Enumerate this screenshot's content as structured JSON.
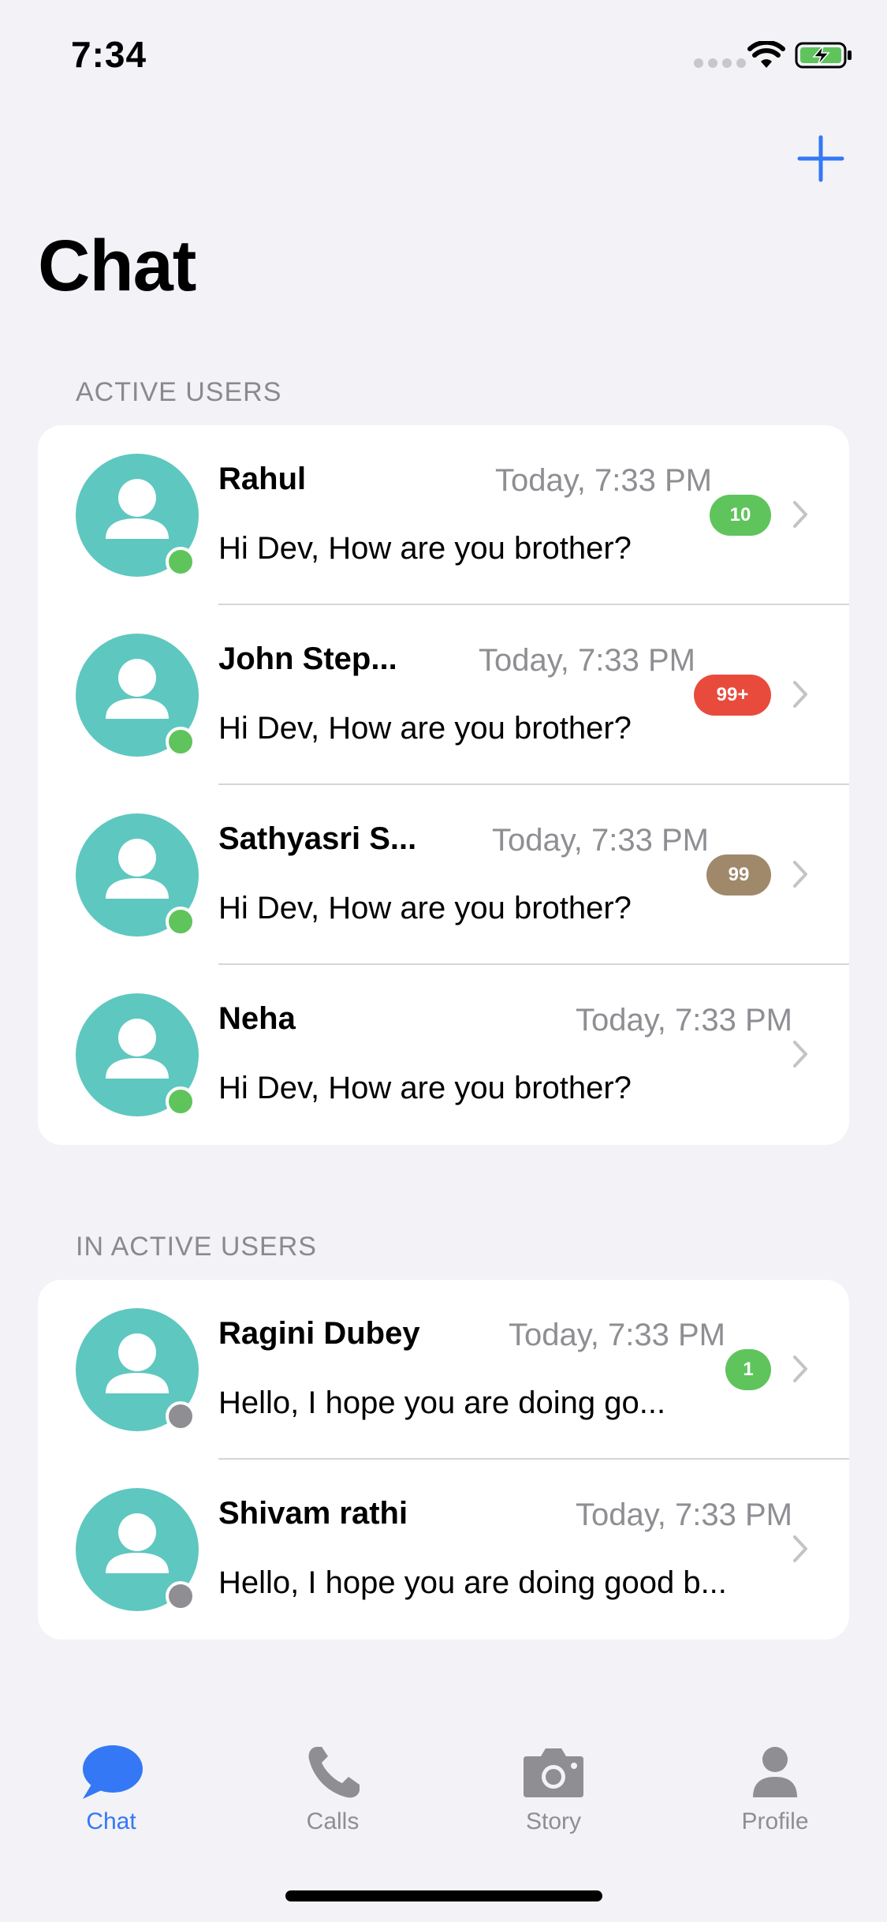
{
  "status_bar": {
    "time": "7:34"
  },
  "header": {
    "title": "Chat"
  },
  "sections": {
    "active": {
      "label": "ACTIVE USERS",
      "rows": [
        {
          "name": "Rahul",
          "time": "Today, 7:33 PM",
          "message": "Hi Dev, How are you brother?",
          "badge": "10",
          "badge_color": "#5fc45c",
          "status": "online"
        },
        {
          "name": "John Step...",
          "time": "Today, 7:33 PM",
          "message": "Hi Dev, How are you brother?",
          "badge": "99+",
          "badge_color": "#e84b3c",
          "status": "online"
        },
        {
          "name": "Sathyasri S...",
          "time": "Today, 7:33 PM",
          "message": "Hi Dev, How are you brother?",
          "badge": "99",
          "badge_color": "#a0896a",
          "status": "online"
        },
        {
          "name": "Neha",
          "time": "Today, 7:33 PM",
          "message": "Hi Dev, How are you brother?",
          "badge": "",
          "badge_color": "",
          "status": "online"
        }
      ]
    },
    "inactive": {
      "label": "IN ACTIVE USERS",
      "rows": [
        {
          "name": "Ragini Dubey",
          "time": "Today, 7:33 PM",
          "message": "Hello, I hope you are doing go...",
          "badge": "1",
          "badge_color": "#5fc45c",
          "status": "offline"
        },
        {
          "name": "Shivam rathi",
          "time": "Today, 7:33 PM",
          "message": "Hello, I hope you are doing good b...",
          "badge": "",
          "badge_color": "",
          "status": "offline"
        }
      ]
    }
  },
  "tabs": [
    {
      "label": "Chat",
      "icon": "chat-bubble-icon",
      "active": true
    },
    {
      "label": "Calls",
      "icon": "phone-icon",
      "active": false
    },
    {
      "label": "Story",
      "icon": "camera-icon",
      "active": false
    },
    {
      "label": "Profile",
      "icon": "person-icon",
      "active": false
    }
  ],
  "colors": {
    "accent": "#3478f6",
    "avatar_bg": "#5ec7c0",
    "online": "#5fc45c",
    "offline": "#8e8e93",
    "background": "#f2f2f7"
  }
}
